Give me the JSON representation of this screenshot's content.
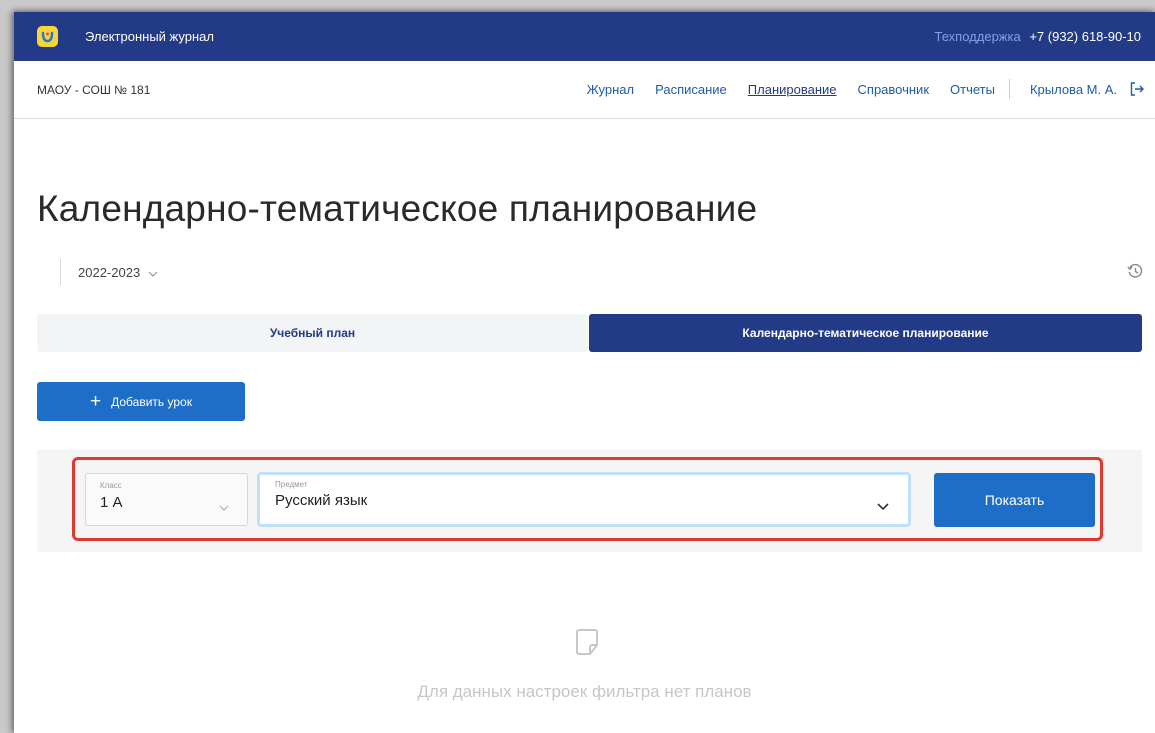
{
  "app": {
    "title": "Электронный журнал"
  },
  "support": {
    "label": "Техподдержка",
    "phone": "+7 (932) 618-90-10"
  },
  "header": {
    "school": "МАОУ - СОШ № 181",
    "nav": [
      {
        "label": "Журнал",
        "active": false
      },
      {
        "label": "Расписание",
        "active": false
      },
      {
        "label": "Планирование",
        "active": true
      },
      {
        "label": "Справочник",
        "active": false
      },
      {
        "label": "Отчеты",
        "active": false
      }
    ],
    "user": "Крылова М. А."
  },
  "page": {
    "title": "Календарно-тематическое планирование",
    "year": "2022-2023"
  },
  "tabs": [
    {
      "label": "Учебный план",
      "active": false
    },
    {
      "label": "Календарно-тематическое планирование",
      "active": true
    }
  ],
  "actions": {
    "add_lesson": "Добавить урок"
  },
  "filter": {
    "class_label": "Класс",
    "class_value": "1 А",
    "subject_label": "Предмет",
    "subject_value": "Русский язык",
    "show_button": "Показать"
  },
  "empty_state": {
    "message": "Для данных настроек фильтра нет планов"
  },
  "colors": {
    "topbar": "#233a86",
    "primary_button": "#1e6ec8",
    "link": "#1e5ba8",
    "highlight": "#e03a30",
    "logo": "#f7d43a"
  },
  "icons": [
    "logo-icon",
    "logout-icon",
    "chevron-down-icon",
    "history-icon",
    "plus-icon",
    "document-icon"
  ]
}
